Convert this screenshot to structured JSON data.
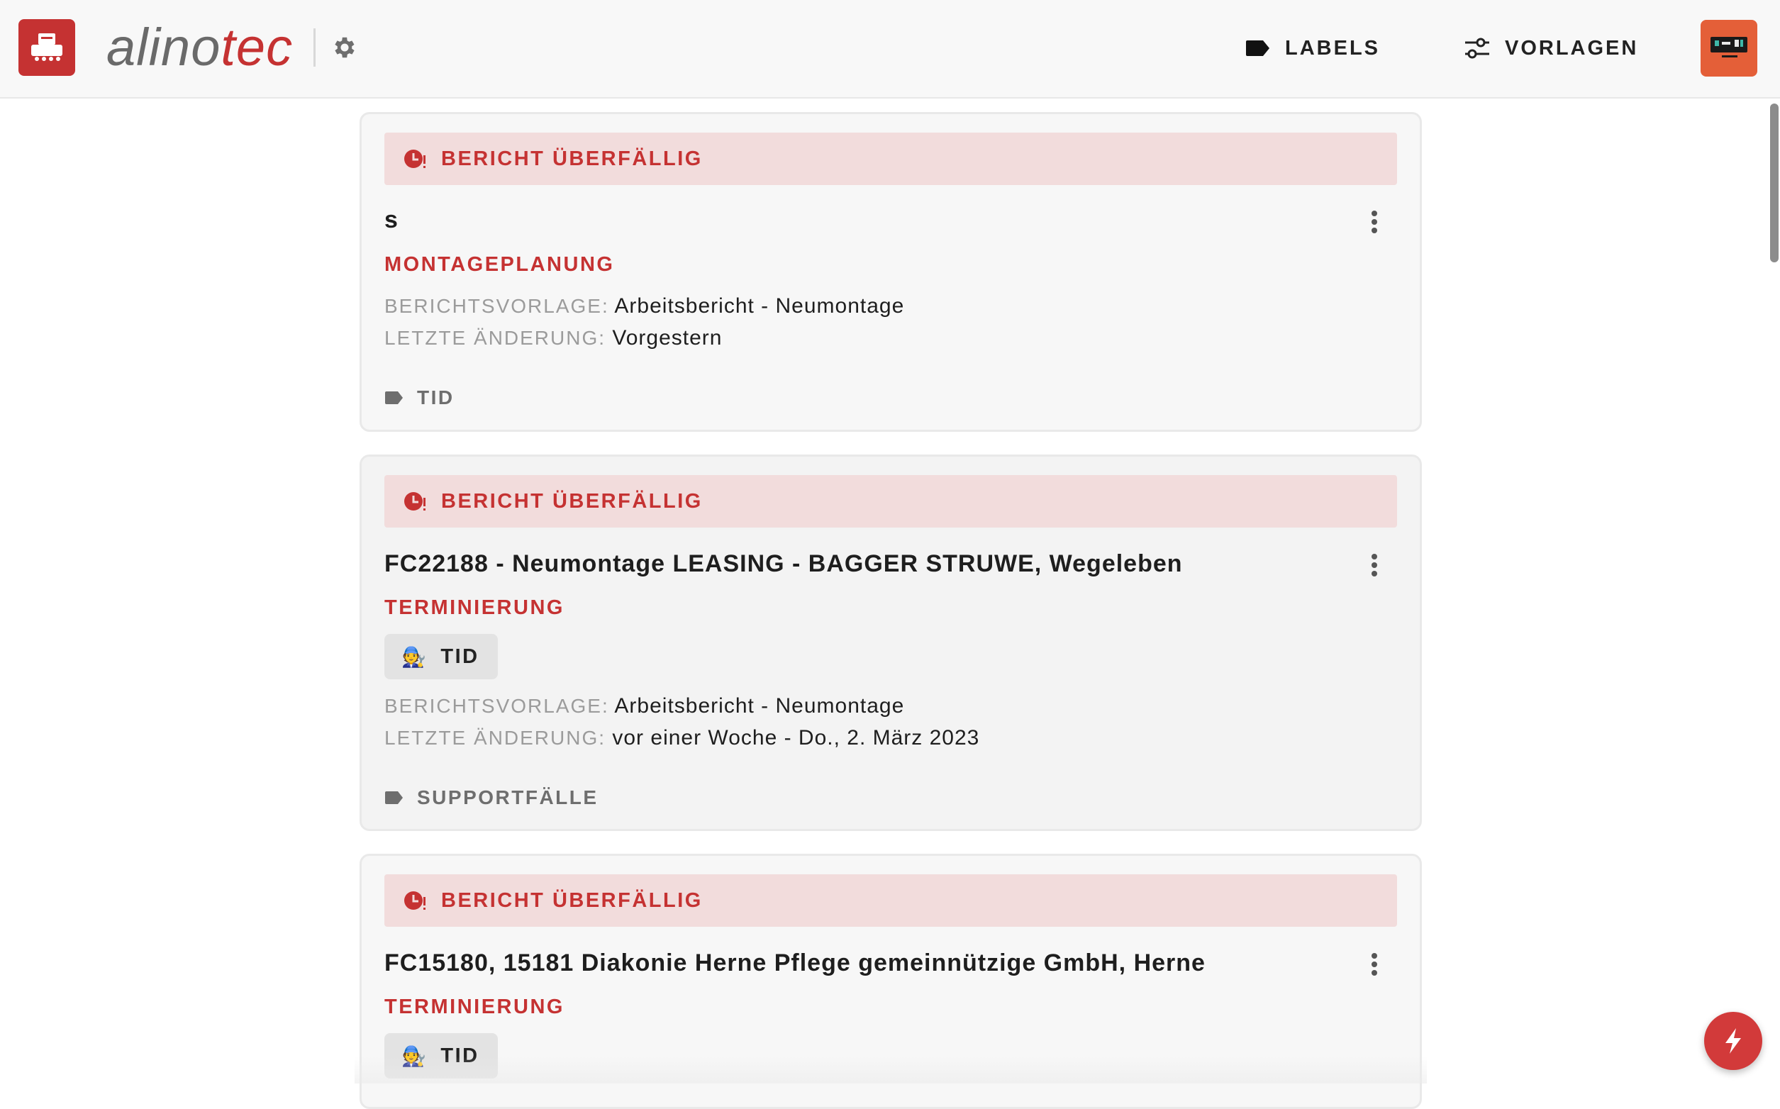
{
  "header": {
    "logo_main": "alino",
    "logo_accent": "tec",
    "nav": {
      "labels": "LABELS",
      "vorlagen": "VORLAGEN"
    }
  },
  "reports": [
    {
      "banner": "BERICHT ÜBERFÄLLIG",
      "title": "s",
      "status": "MONTAGEPLANUNG",
      "template_key": "BERICHTSVORLAGE:",
      "template_value": "Arbeitsbericht - Neumontage",
      "changed_key": "LETZTE ÄNDERUNG:",
      "changed_value": "Vorgestern",
      "label": "TID"
    },
    {
      "banner": "BERICHT ÜBERFÄLLIG",
      "title": "FC22188 - Neumontage LEASING - BAGGER STRUWE, Wegeleben",
      "status": "TERMINIERUNG",
      "assignee": "TID",
      "assignee_emoji": "🧑‍🔧",
      "template_key": "BERICHTSVORLAGE:",
      "template_value": "Arbeitsbericht - Neumontage",
      "changed_key": "LETZTE ÄNDERUNG:",
      "changed_value": "vor einer Woche - Do., 2. März 2023",
      "label": "SUPPORTFÄLLE"
    },
    {
      "banner": "BERICHT ÜBERFÄLLIG",
      "title": "FC15180, 15181 Diakonie Herne Pflege gemeinnützige GmbH, Herne",
      "status": "TERMINIERUNG",
      "assignee": "TID",
      "assignee_emoji": "🧑‍🔧"
    }
  ],
  "colors": {
    "accent": "#c53232",
    "banner_bg": "#f2dcdc",
    "avatar": "#e45f38"
  }
}
